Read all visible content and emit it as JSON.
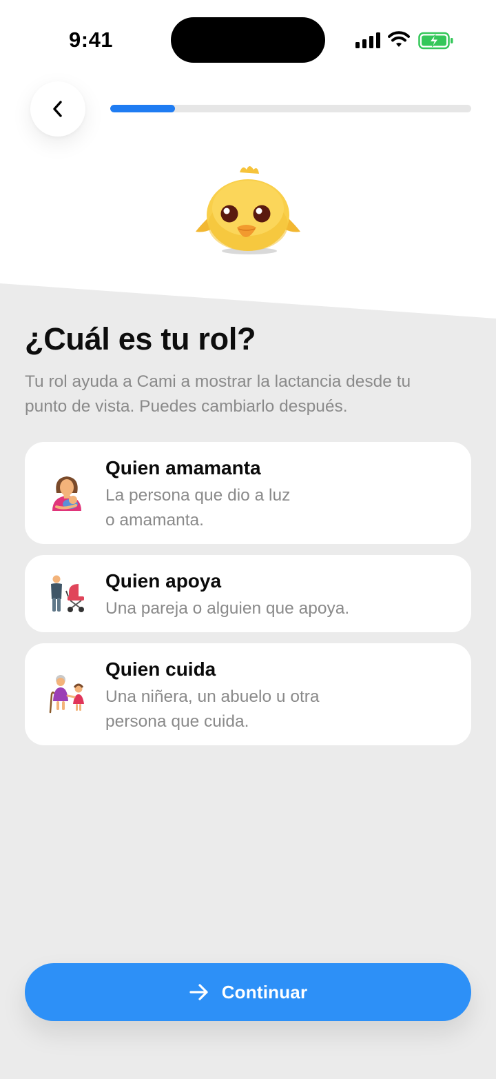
{
  "status_bar": {
    "time": "9:41",
    "icons": [
      "signal-icon",
      "wifi-icon",
      "battery-charging-icon"
    ]
  },
  "header": {
    "back_icon": "chevron-left-icon",
    "progress_fraction": 0.18,
    "accent_color": "#1f7cf2"
  },
  "mascot": {
    "icon": "baby-chick-icon"
  },
  "main": {
    "title": "¿Cuál es tu rol?",
    "subtitle_line1": "Tu rol ayuda a Cami a mostrar la lactancia desde tu",
    "subtitle_line2": "punto de vista. Puedes cambiarlo después."
  },
  "roles": [
    {
      "icon": "breastfeeding-person-icon",
      "title": "Quien amamanta",
      "desc_line1": "La persona que dio a luz",
      "desc_line2": "o amamanta."
    },
    {
      "icon": "person-with-stroller-icon",
      "title": "Quien apoya",
      "desc_line1": "Una pareja o alguien que apoya.",
      "desc_line2": ""
    },
    {
      "icon": "grandmother-with-child-icon",
      "title": "Quien cuida",
      "desc_line1": "Una niñera, un abuelo u otra",
      "desc_line2": "persona que cuida."
    }
  ],
  "footer": {
    "continue_label": "Continuar",
    "continue_icon": "arrow-right-icon",
    "button_color": "#2d90f7"
  }
}
